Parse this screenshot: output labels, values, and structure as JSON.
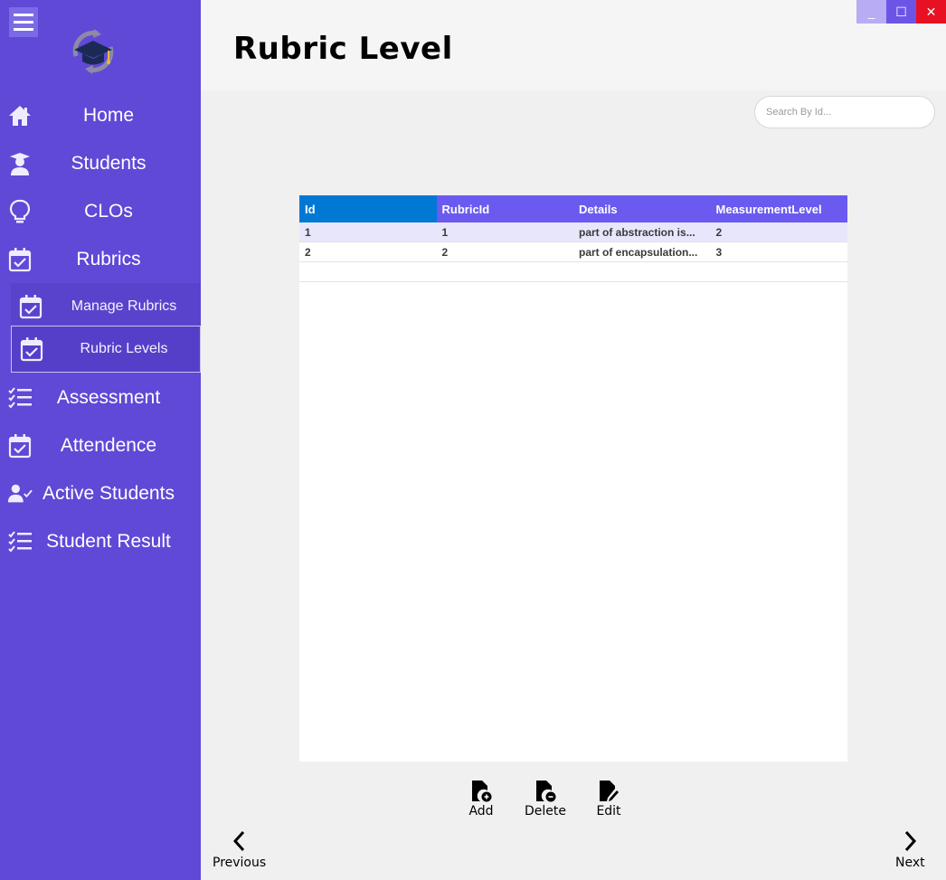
{
  "window": {
    "minimize": "_",
    "maximize": "☐",
    "close": "✕"
  },
  "header": {
    "title": "Rubric Level"
  },
  "search": {
    "placeholder": "Search By Id..."
  },
  "sidebar": {
    "items": [
      {
        "label": "Home",
        "icon": "home-icon"
      },
      {
        "label": "Students",
        "icon": "student-icon"
      },
      {
        "label": "CLOs",
        "icon": "lightbulb-icon"
      },
      {
        "label": "Rubrics",
        "icon": "calendar-check-icon"
      },
      {
        "label": "Assessment",
        "icon": "checklist-icon"
      },
      {
        "label": "Attendence",
        "icon": "calendar-check-icon"
      },
      {
        "label": "Active Students",
        "icon": "user-check-icon"
      },
      {
        "label": "Student Result",
        "icon": "checklist-icon"
      }
    ],
    "sub_items": [
      {
        "label": "Manage Rubrics",
        "icon": "calendar-check-icon"
      },
      {
        "label": "Rubric Levels",
        "icon": "calendar-check-icon",
        "active": true
      }
    ]
  },
  "table": {
    "columns": [
      "Id",
      "RubricId",
      "Details",
      "MeasurementLevel"
    ],
    "rows": [
      [
        "1",
        "1",
        "part of abstraction is...",
        "2"
      ],
      [
        "2",
        "2",
        "part of encapsulation...",
        "3"
      ]
    ]
  },
  "actions": {
    "add": "Add",
    "delete": "Delete",
    "edit": "Edit"
  },
  "pager": {
    "previous": "Previous",
    "next": "Next"
  },
  "colors": {
    "sidebar": "#6049d6",
    "header_col": "#6a5af0",
    "selected_col": "#0078d4",
    "close": "#e81123"
  }
}
